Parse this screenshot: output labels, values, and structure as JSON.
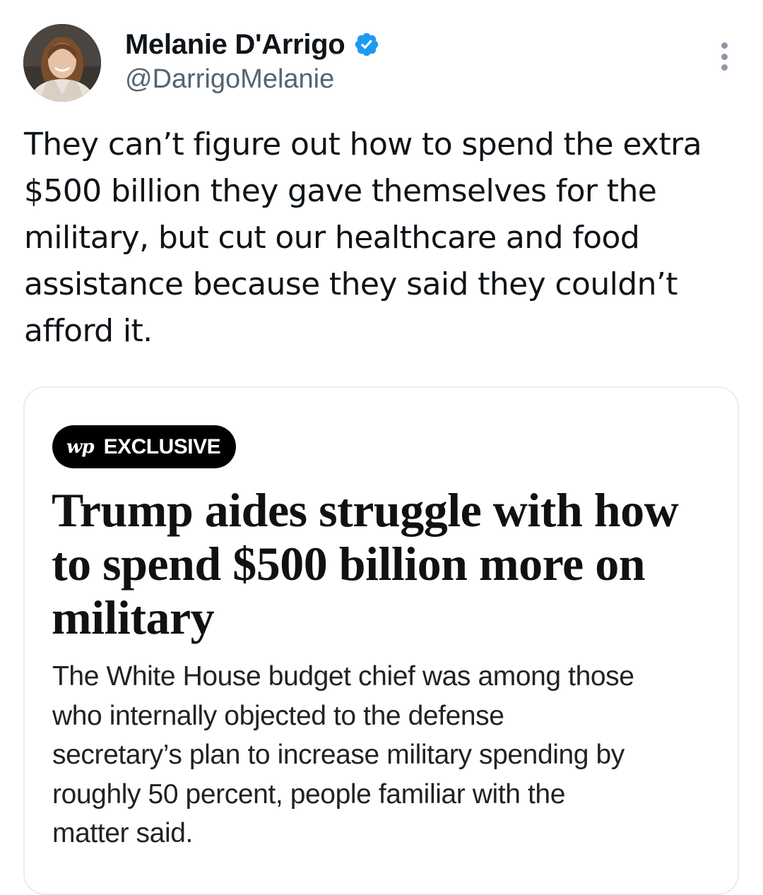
{
  "author": {
    "display_name": "Melanie D'Arrigo",
    "handle": "@DarrigoMelanie",
    "verified": true,
    "avatar_icon": "profile-photo",
    "verified_color": "#1d9bf0"
  },
  "more_menu_icon": "vertical-ellipsis-icon",
  "tweet": {
    "text": "They can’t figure out how to spend the extra\n$500 billion they gave themselves for the\nmilitary, but cut our healthcare and food\nassistance because they said they couldn’t\nafford it."
  },
  "card": {
    "badge_logo": "wp",
    "badge_label": "EXCLUSIVE",
    "headline": "Trump aides struggle with how\nto spend $500 billion more on\nmilitary",
    "dek": "The White House budget chief was among those\nwho internally objected to the defense\nsecretary’s plan to increase military spending by\nroughly 50 percent, people familiar with the\nmatter said."
  }
}
